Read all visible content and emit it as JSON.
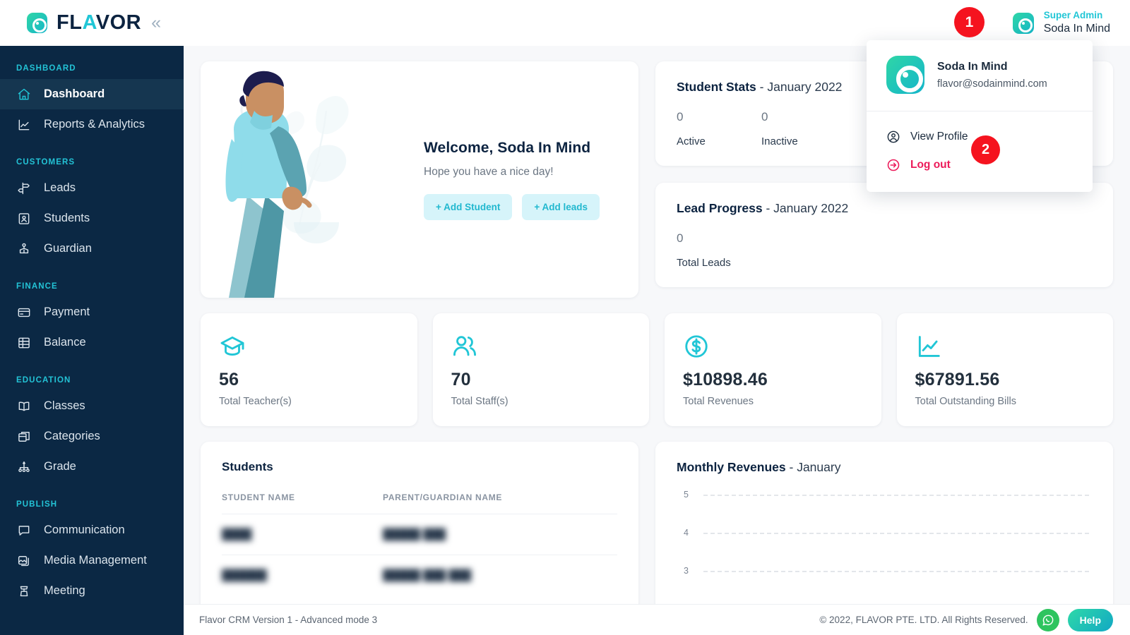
{
  "brand": {
    "name": "FLAVOR",
    "collapse_icon": "chevron-double-left-icon"
  },
  "header": {
    "user_role": "Super Admin",
    "user_name": "Soda In Mind",
    "annotations": [
      {
        "label": "1"
      },
      {
        "label": "2"
      }
    ]
  },
  "dropdown": {
    "name": "Soda In Mind",
    "email": "flavor@sodainmind.com",
    "view_profile_label": "View Profile",
    "logout_label": "Log out"
  },
  "sidebar": {
    "groups": [
      {
        "label": "DASHBOARD",
        "items": [
          {
            "label": "Dashboard",
            "icon": "home-icon",
            "active": true
          },
          {
            "label": "Reports & Analytics",
            "icon": "chart-line-icon",
            "active": false
          }
        ]
      },
      {
        "label": "CUSTOMERS",
        "items": [
          {
            "label": "Leads",
            "icon": "signpost-icon",
            "active": false
          },
          {
            "label": "Students",
            "icon": "id-card-icon",
            "active": false
          },
          {
            "label": "Guardian",
            "icon": "guardian-icon",
            "active": false
          }
        ]
      },
      {
        "label": "FINANCE",
        "items": [
          {
            "label": "Payment",
            "icon": "credit-card-icon",
            "active": false
          },
          {
            "label": "Balance",
            "icon": "ledger-icon",
            "active": false
          }
        ]
      },
      {
        "label": "EDUCATION",
        "items": [
          {
            "label": "Classes",
            "icon": "open-book-icon",
            "active": false
          },
          {
            "label": "Categories",
            "icon": "stacked-box-icon",
            "active": false
          },
          {
            "label": "Grade",
            "icon": "hierarchy-icon",
            "active": false
          }
        ]
      },
      {
        "label": "PUBLISH",
        "items": [
          {
            "label": "Communication",
            "icon": "chat-bubble-icon",
            "active": false
          },
          {
            "label": "Media Management",
            "icon": "image-stack-icon",
            "active": false
          },
          {
            "label": "Meeting",
            "icon": "podium-icon",
            "active": false
          }
        ]
      }
    ]
  },
  "welcome": {
    "title": "Welcome, Soda In Mind",
    "subtitle": "Hope you have a nice day!",
    "add_student_label": "+ Add Student",
    "add_leads_label": "+ Add leads"
  },
  "student_stats": {
    "title": "Student Stats",
    "period": "- January 2022",
    "active_value": "0",
    "active_label": "Active",
    "inactive_value": "0",
    "inactive_label": "Inactive"
  },
  "lead_progress": {
    "title": "Lead Progress",
    "period": "- January 2022",
    "total_value": "0",
    "total_label": "Total Leads"
  },
  "kpis": [
    {
      "value": "56",
      "label": "Total Teacher(s)",
      "icon": "graduation-cap-icon"
    },
    {
      "value": "70",
      "label": "Total Staff(s)",
      "icon": "people-icon"
    },
    {
      "value": "$10898.46",
      "label": "Total Revenues",
      "icon": "dollar-circle-icon"
    },
    {
      "value": "$67891.56",
      "label": "Total Outstanding Bills",
      "icon": "chart-line-icon"
    }
  ],
  "students_table": {
    "title": "Students",
    "columns": [
      "STUDENT NAME",
      "PARENT/GUARDIAN NAME"
    ],
    "rows": [
      {
        "student": "████",
        "guardian": "█████ ███"
      },
      {
        "student": "██████",
        "guardian": "█████ ███ ███"
      }
    ]
  },
  "chart_data": {
    "type": "line",
    "title": "Monthly Revenues",
    "subtitle": "- January",
    "xlabel": "",
    "ylabel": "",
    "x": [],
    "values": [],
    "series": [],
    "yticks": [
      "5",
      "4",
      "3"
    ],
    "ylim": [
      3,
      5
    ],
    "grid": true,
    "grid_style": "dashed",
    "legend": "none",
    "note": "Chart area is empty — no data plotted; only horizontal dashed gridlines at y = 5, 4, 3 are visible."
  },
  "footer": {
    "version": "Flavor CRM Version 1 - Advanced mode 3",
    "copyright": "© 2022, FLAVOR PTE. LTD. All Rights Reserved.",
    "help_label": "Help",
    "whatsapp_icon": "whatsapp-icon"
  },
  "colors": {
    "accent_teal": "#21c6d6",
    "sidebar_bg": "#0b2844",
    "sidebar_active": "#153650",
    "annotation_red": "#f5131f",
    "logout_pink": "#ec1b5a",
    "page_bg": "#f7f8fa"
  }
}
